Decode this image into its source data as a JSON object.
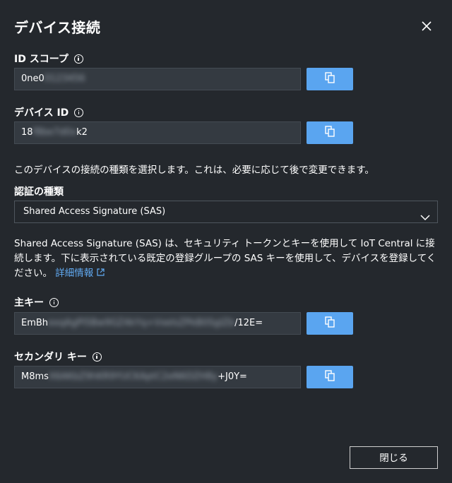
{
  "dialog": {
    "title": "デバイス接続",
    "close_icon": "close-icon"
  },
  "id_scope": {
    "label": "ID スコープ",
    "value_visible": "0ne0",
    "value_masked": "0123456"
  },
  "device_id": {
    "label": "デバイス ID",
    "value_prefix": "18",
    "value_masked": "f8be7d0x",
    "value_suffix": "k2"
  },
  "connection": {
    "description": "このデバイスの接続の種類を選択します。これは、必要に応じて後で変更できます。",
    "auth_label": "認証の種類",
    "auth_selected": "Shared Access Signature (SAS)",
    "sas_description": "Shared Access Signature (SAS) は、セキュリティ トークンとキーを使用して IoT Central に接続します。下に表示されている既定の登録グループの SAS キーを使用して、デバイスを登録してください。",
    "more_info_link": "詳細情報"
  },
  "primary_key": {
    "label": "主キー",
    "value_prefix": "EmBh",
    "value_masked": "exqAgPl5Bw9GZ4kYq+VxeIsZPkB0SgIZb",
    "value_suffix": "/12E="
  },
  "secondary_key": {
    "label": "セカンダリ キー",
    "value_prefix": "M8ms",
    "value_masked": "X6AKbZ9hKR9YUCKAptC2eN6DZH8y",
    "value_suffix": "+J0Y="
  },
  "footer": {
    "close_label": "閉じる"
  },
  "colors": {
    "background": "#24282d",
    "field_bg": "#343a41",
    "accent": "#5aa5f0",
    "link": "#61aaf2"
  }
}
